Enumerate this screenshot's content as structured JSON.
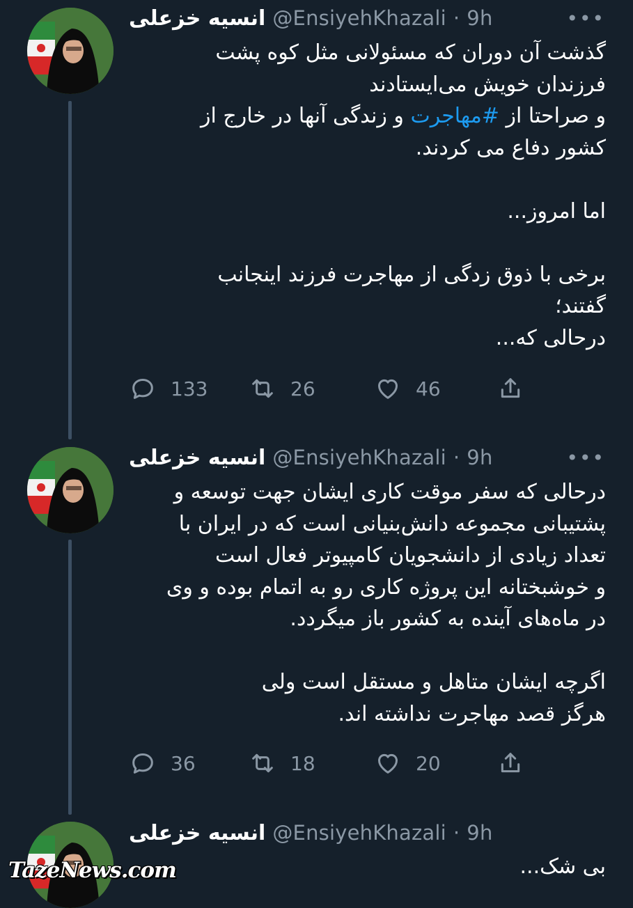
{
  "tweets": [
    {
      "name": "انسیه خزعلی",
      "handle": "@EnsiyehKhazali",
      "sep": "·",
      "time": "9h",
      "lines": [
        "گذشت آن دوران که مسئولانی مثل کوه پشت",
        "فرزندان خویش می‌ایستادند",
        "",
        "کشور دفاع می کردند.",
        "",
        "اما امروز...",
        "",
        "برخی با ذوق زدگی از مهاجرت فرزند اینجانب",
        "گفتند؛",
        "درحالی که..."
      ],
      "line3_before": "و صراحتا از ",
      "line3_hashtag": "#مهاجرت",
      "line3_after": " و زندگی آنها در خارج از",
      "replies": "133",
      "retweets": "26",
      "likes": "46"
    },
    {
      "name": "انسیه خزعلی",
      "handle": "@EnsiyehKhazali",
      "sep": "·",
      "time": "9h",
      "lines": [
        "درحالی که سفر موقت کاری ایشان جهت توسعه و",
        "پشتیبانی مجموعه دانش‌بنیانی است که در ایران با",
        "تعداد زیادی از دانشجویان کامپیوتر فعال است",
        "و خوشبختانه این پروژه کاری رو به اتمام بوده و وی",
        "در ماه‌های آینده به کشور باز میگردد.",
        "",
        "اگرچه ایشان متاهل و مستقل است ولی",
        "هرگز قصد مهاجرت نداشته اند."
      ],
      "replies": "36",
      "retweets": "18",
      "likes": "20"
    },
    {
      "name": "انسیه خزعلی",
      "handle": "@EnsiyehKhazali",
      "sep": "·",
      "time": "9h",
      "lines": [
        "بی شک..."
      ]
    }
  ],
  "watermark": "TazeNews.com",
  "colors": {
    "background": "#15202b",
    "secondary_text": "#8b98a5",
    "link": "#1d9bf0",
    "thread_line": "#3d4f63"
  },
  "icons": [
    "reply-icon",
    "retweet-icon",
    "like-icon",
    "share-icon",
    "more-icon"
  ]
}
